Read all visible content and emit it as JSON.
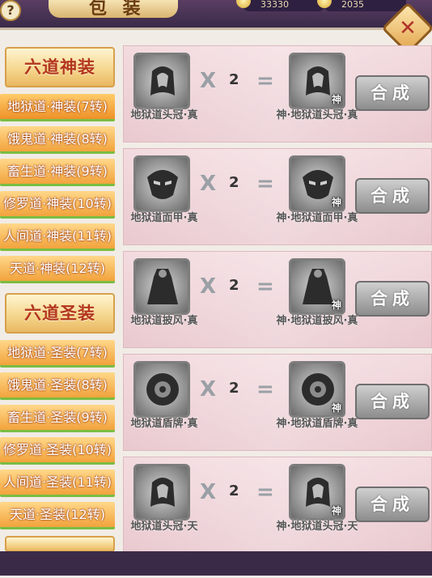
{
  "header": {
    "title": "包 装",
    "help_label": "?",
    "currency_1": "33330",
    "currency_2": "2035"
  },
  "sidebar": {
    "section_1": "六道神装",
    "tabs_1": [
      "地狱道·神装(7转)",
      "饿鬼道·神装(8转)",
      "畜生道·神装(9转)",
      "修罗道·神装(10转)",
      "人间道·神装(11转)",
      "天道·神装(12转)"
    ],
    "section_2": "六道圣装",
    "tabs_2": [
      "地狱道·圣装(7转)",
      "饿鬼道·圣装(8转)",
      "畜生道·圣装(9转)",
      "修罗道·圣装(10转)",
      "人间道·圣装(11转)",
      "天道·圣装(12转)"
    ]
  },
  "recipes": [
    {
      "input_name": "地狱道头冠·真",
      "quantity": "2",
      "output_name": "神·地狱道头冠·真",
      "icon": "helmet-icon"
    },
    {
      "input_name": "地狱道面甲·真",
      "quantity": "2",
      "output_name": "神·地狱道面甲·真",
      "icon": "mask-icon"
    },
    {
      "input_name": "地狱道披风·真",
      "quantity": "2",
      "output_name": "神·地狱道披风·真",
      "icon": "cloak-icon"
    },
    {
      "input_name": "地狱道盾牌·真",
      "quantity": "2",
      "output_name": "神·地狱道盾牌·真",
      "icon": "shield-icon"
    },
    {
      "input_name": "地狱道头冠·天",
      "quantity": "2",
      "output_name": "神·地狱道头冠·天",
      "icon": "helmet-icon"
    }
  ],
  "labels": {
    "times": "X",
    "equals": "=",
    "synthesize": "合成",
    "god_mark": "神"
  }
}
